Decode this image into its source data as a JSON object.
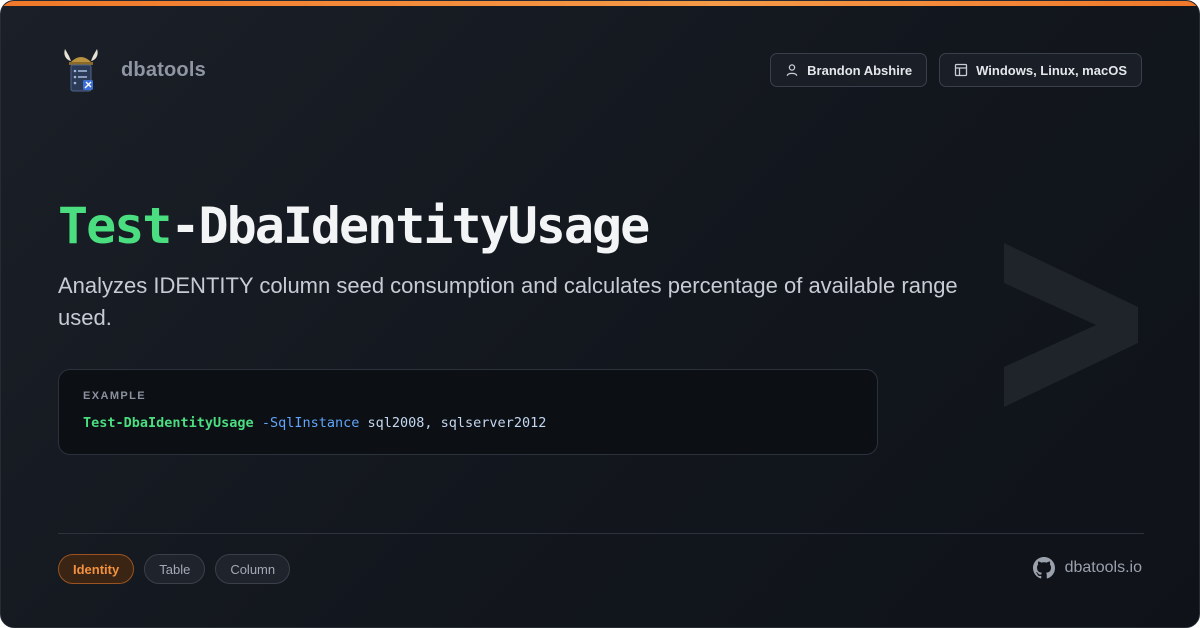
{
  "brand": {
    "name": "dbatools",
    "logo_icon": "viking-server-logo-icon"
  },
  "meta": [
    {
      "icon": "user-icon",
      "label": "Brandon Abshire"
    },
    {
      "icon": "layout-icon",
      "label": "Windows, Linux, macOS"
    }
  ],
  "command": {
    "verb": "Test",
    "noun": "-DbaIdentityUsage",
    "description": "Analyzes IDENTITY column seed consumption and calculates percentage of available range used."
  },
  "example": {
    "label": "EXAMPLE",
    "command": "Test-DbaIdentityUsage",
    "parameter": "-SqlInstance",
    "arguments": "sql2008, sqlserver2012"
  },
  "tags": [
    {
      "label": "Identity",
      "primary": true
    },
    {
      "label": "Table",
      "primary": false
    },
    {
      "label": "Column",
      "primary": false
    }
  ],
  "footer": {
    "site": "dbatools.io",
    "icon": "github-icon"
  },
  "colors": {
    "accent": "#f0782a",
    "verb": "#4ade80",
    "parameter": "#60a5fa",
    "background": "#161a21"
  }
}
